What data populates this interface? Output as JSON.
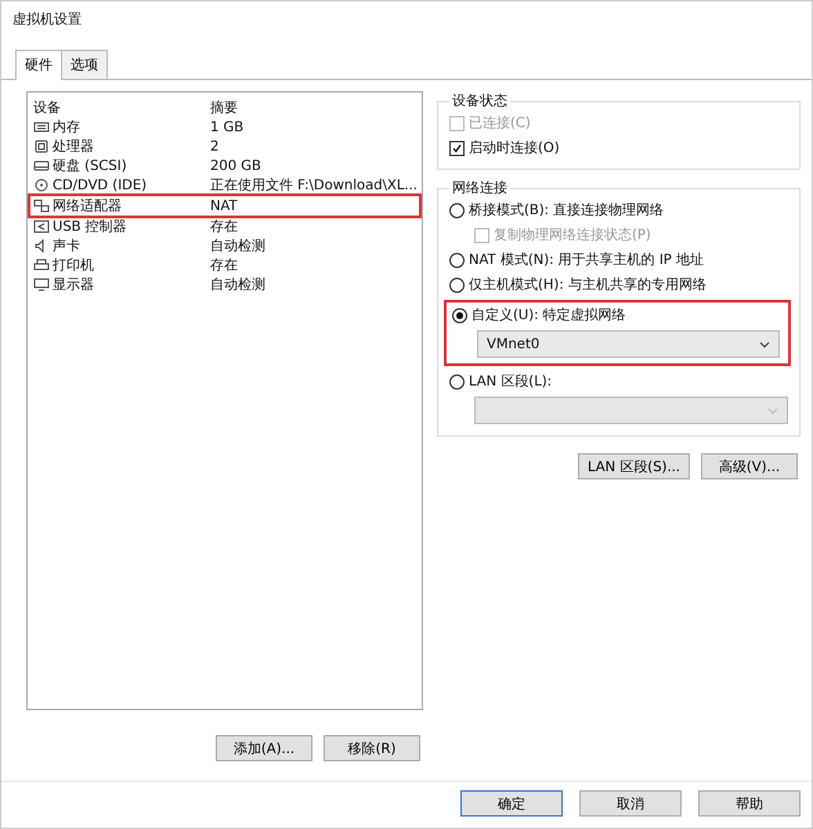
{
  "window": {
    "title": "虚拟机设置"
  },
  "tabs": [
    {
      "label": "硬件",
      "selected": true
    },
    {
      "label": "选项",
      "selected": false
    }
  ],
  "devices": {
    "columns": [
      "设备",
      "摘要"
    ],
    "rows": [
      {
        "name": "内存",
        "summary": "1 GB",
        "highlighted": false
      },
      {
        "name": "处理器",
        "summary": "2",
        "highlighted": false
      },
      {
        "name": "硬盘 (SCSI)",
        "summary": "200 GB",
        "highlighted": false
      },
      {
        "name": "CD/DVD (IDE)",
        "summary": "正在使用文件 F:\\Download\\XL...",
        "highlighted": false
      },
      {
        "name": "网络适配器",
        "summary": "NAT",
        "highlighted": true
      },
      {
        "name": "USB 控制器",
        "summary": "存在",
        "highlighted": false
      },
      {
        "name": "声卡",
        "summary": "自动检测",
        "highlighted": false
      },
      {
        "name": "打印机",
        "summary": "存在",
        "highlighted": false
      },
      {
        "name": "显示器",
        "summary": "自动检测",
        "highlighted": false
      }
    ],
    "buttons": [
      "添加(A)...",
      "移除(R)"
    ]
  },
  "device_status": {
    "title": "设备状态",
    "options": [
      {
        "label": "已连接(C)",
        "checked": false,
        "disabled": true
      },
      {
        "label": "启动时连接(O)",
        "checked": true,
        "disabled": false
      }
    ]
  },
  "network": {
    "title": "网络连接",
    "options": [
      {
        "kind": "radio",
        "label": "桥接模式(B): 直接连接物理网络",
        "selected": false,
        "highlighted": false
      },
      {
        "kind": "checkbox",
        "label": "复制物理网络连接状态(P)",
        "checked": false,
        "disabled": true,
        "highlighted": false
      },
      {
        "kind": "radio",
        "label": "NAT 模式(N): 用于共享主机的 IP 地址",
        "selected": false,
        "highlighted": false
      },
      {
        "kind": "radio",
        "label": "仅主机模式(H): 与主机共享的专用网络",
        "selected": false,
        "highlighted": false
      },
      {
        "kind": "radio",
        "label": "自定义(U): 特定虚拟网络",
        "selected": true,
        "highlighted": true
      },
      {
        "kind": "select",
        "value": "VMnet0",
        "disabled": false,
        "highlighted": true
      },
      {
        "kind": "radio",
        "label": "LAN 区段(L):",
        "selected": false,
        "highlighted": false
      },
      {
        "kind": "select",
        "disabled": true,
        "highlighted": false
      }
    ],
    "buttons": [
      "LAN 区段(S)...",
      "高级(V)..."
    ]
  },
  "footer_buttons": [
    {
      "label": "确定",
      "default": true
    },
    {
      "label": "取消",
      "default": false
    },
    {
      "label": "帮助",
      "default": false
    }
  ]
}
